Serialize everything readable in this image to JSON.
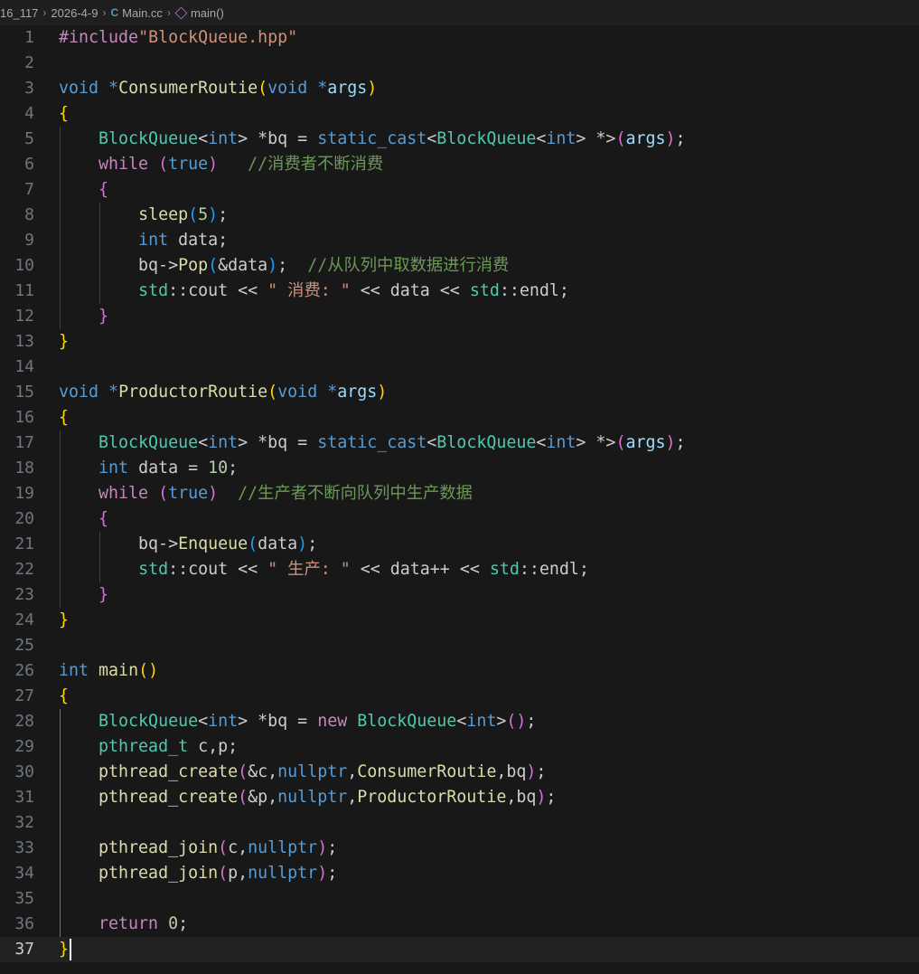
{
  "breadcrumb": {
    "folder": "16_117",
    "subfolder": "2026-4-9",
    "file": "Main.cc",
    "symbol": "main()"
  },
  "editor": {
    "cursor_line": 37,
    "lines": [
      {
        "n": "1",
        "tokens": [
          [
            "inc",
            "#include"
          ],
          [
            "str",
            "\"BlockQueue.hpp\""
          ]
        ]
      },
      {
        "n": "2",
        "tokens": []
      },
      {
        "n": "3",
        "tokens": [
          [
            "kw",
            "void"
          ],
          [
            "",
            "",
            " "
          ],
          [
            "kw",
            "*"
          ],
          [
            "fn",
            "ConsumerRoutie"
          ],
          [
            "b1",
            "("
          ],
          [
            "kw",
            "void"
          ],
          [
            "",
            "",
            " "
          ],
          [
            "kw",
            "*"
          ],
          [
            "pm",
            "args"
          ],
          [
            "b1",
            ")"
          ]
        ]
      },
      {
        "n": "4",
        "tokens": [
          [
            "b1",
            "{"
          ]
        ]
      },
      {
        "n": "5",
        "tokens": [
          [
            "",
            "    "
          ],
          [
            "ty",
            "BlockQueue"
          ],
          [
            "",
            "<"
          ],
          [
            "kw",
            "int"
          ],
          [
            "",
            "> *bq = "
          ],
          [
            "kw",
            "static_cast"
          ],
          [
            "",
            "<"
          ],
          [
            "ty",
            "BlockQueue"
          ],
          [
            "",
            "<"
          ],
          [
            "kw",
            "int"
          ],
          [
            "",
            "> *>"
          ],
          [
            "b2",
            "("
          ],
          [
            "pm",
            "args"
          ],
          [
            "b2",
            ")"
          ],
          [
            "",
            ";"
          ]
        ]
      },
      {
        "n": "6",
        "tokens": [
          [
            "",
            "    "
          ],
          [
            "ctl",
            "while"
          ],
          [
            "",
            " "
          ],
          [
            "b2",
            "("
          ],
          [
            "kw",
            "true"
          ],
          [
            "b2",
            ")"
          ],
          [
            "",
            "   "
          ],
          [
            "cm",
            "//消费者不断消费"
          ]
        ]
      },
      {
        "n": "7",
        "tokens": [
          [
            "",
            "    "
          ],
          [
            "b2",
            "{"
          ]
        ]
      },
      {
        "n": "8",
        "tokens": [
          [
            "",
            "        "
          ],
          [
            "fn",
            "sleep"
          ],
          [
            "b3",
            "("
          ],
          [
            "num",
            "5"
          ],
          [
            "b3",
            ")"
          ],
          [
            "",
            ";"
          ]
        ]
      },
      {
        "n": "9",
        "tokens": [
          [
            "",
            "        "
          ],
          [
            "kw",
            "int"
          ],
          [
            "",
            " data;"
          ]
        ]
      },
      {
        "n": "10",
        "tokens": [
          [
            "",
            "        bq->"
          ],
          [
            "fn",
            "Pop"
          ],
          [
            "b3",
            "("
          ],
          [
            "",
            "&data"
          ],
          [
            "b3",
            ")"
          ],
          [
            "",
            ";  "
          ],
          [
            "cm",
            "//从队列中取数据进行消费"
          ]
        ]
      },
      {
        "n": "11",
        "tokens": [
          [
            "",
            "        "
          ],
          [
            "ty",
            "std"
          ],
          [
            "",
            "::cout << "
          ],
          [
            "str",
            "\" 消费: \""
          ],
          [
            "",
            " << data << "
          ],
          [
            "ty",
            "std"
          ],
          [
            "",
            "::endl;"
          ]
        ]
      },
      {
        "n": "12",
        "tokens": [
          [
            "",
            "    "
          ],
          [
            "b2",
            "}"
          ]
        ]
      },
      {
        "n": "13",
        "tokens": [
          [
            "b1",
            "}"
          ]
        ]
      },
      {
        "n": "14",
        "tokens": []
      },
      {
        "n": "15",
        "tokens": [
          [
            "kw",
            "void"
          ],
          [
            "",
            " "
          ],
          [
            "kw",
            "*"
          ],
          [
            "fn",
            "ProductorRoutie"
          ],
          [
            "b1",
            "("
          ],
          [
            "kw",
            "void"
          ],
          [
            "",
            " "
          ],
          [
            "kw",
            "*"
          ],
          [
            "pm",
            "args"
          ],
          [
            "b1",
            ")"
          ]
        ]
      },
      {
        "n": "16",
        "tokens": [
          [
            "b1",
            "{"
          ]
        ]
      },
      {
        "n": "17",
        "tokens": [
          [
            "",
            "    "
          ],
          [
            "ty",
            "BlockQueue"
          ],
          [
            "",
            "<"
          ],
          [
            "kw",
            "int"
          ],
          [
            "",
            "> *bq = "
          ],
          [
            "kw",
            "static_cast"
          ],
          [
            "",
            "<"
          ],
          [
            "ty",
            "BlockQueue"
          ],
          [
            "",
            "<"
          ],
          [
            "kw",
            "int"
          ],
          [
            "",
            "> *>"
          ],
          [
            "b2",
            "("
          ],
          [
            "pm",
            "args"
          ],
          [
            "b2",
            ")"
          ],
          [
            "",
            ";"
          ]
        ]
      },
      {
        "n": "18",
        "tokens": [
          [
            "",
            "    "
          ],
          [
            "kw",
            "int"
          ],
          [
            "",
            " data = "
          ],
          [
            "num",
            "10"
          ],
          [
            "",
            ";"
          ]
        ]
      },
      {
        "n": "19",
        "tokens": [
          [
            "",
            "    "
          ],
          [
            "ctl",
            "while"
          ],
          [
            "",
            " "
          ],
          [
            "b2",
            "("
          ],
          [
            "kw",
            "true"
          ],
          [
            "b2",
            ")"
          ],
          [
            "",
            "  "
          ],
          [
            "cm",
            "//生产者不断向队列中生产数据"
          ]
        ]
      },
      {
        "n": "20",
        "tokens": [
          [
            "",
            "    "
          ],
          [
            "b2",
            "{"
          ]
        ]
      },
      {
        "n": "21",
        "tokens": [
          [
            "",
            "        bq->"
          ],
          [
            "fn",
            "Enqueue"
          ],
          [
            "b3",
            "("
          ],
          [
            "",
            "data"
          ],
          [
            "b3",
            ")"
          ],
          [
            "",
            ";"
          ]
        ]
      },
      {
        "n": "22",
        "tokens": [
          [
            "",
            "        "
          ],
          [
            "ty",
            "std"
          ],
          [
            "",
            "::cout << "
          ],
          [
            "str",
            "\" 生产: \""
          ],
          [
            "",
            " << data++ << "
          ],
          [
            "ty",
            "std"
          ],
          [
            "",
            "::endl;"
          ]
        ]
      },
      {
        "n": "23",
        "tokens": [
          [
            "",
            "    "
          ],
          [
            "b2",
            "}"
          ]
        ]
      },
      {
        "n": "24",
        "tokens": [
          [
            "b1",
            "}"
          ]
        ]
      },
      {
        "n": "25",
        "tokens": []
      },
      {
        "n": "26",
        "tokens": [
          [
            "kw",
            "int"
          ],
          [
            "",
            " "
          ],
          [
            "fn",
            "main"
          ],
          [
            "b1",
            "()"
          ]
        ]
      },
      {
        "n": "27",
        "tokens": [
          [
            "b1",
            "{"
          ]
        ]
      },
      {
        "n": "28",
        "tokens": [
          [
            "",
            "    "
          ],
          [
            "ty",
            "BlockQueue"
          ],
          [
            "",
            "<"
          ],
          [
            "kw",
            "int"
          ],
          [
            "",
            "> *bq = "
          ],
          [
            "ctl",
            "new"
          ],
          [
            "",
            " "
          ],
          [
            "ty",
            "BlockQueue"
          ],
          [
            "",
            "<"
          ],
          [
            "kw",
            "int"
          ],
          [
            "",
            ">"
          ],
          [
            "b2",
            "()"
          ],
          [
            "",
            ";"
          ]
        ]
      },
      {
        "n": "29",
        "tokens": [
          [
            "",
            "    "
          ],
          [
            "ty",
            "pthread_t"
          ],
          [
            "",
            " c,p;"
          ]
        ]
      },
      {
        "n": "30",
        "tokens": [
          [
            "",
            "    "
          ],
          [
            "fn",
            "pthread_create"
          ],
          [
            "b2",
            "("
          ],
          [
            "",
            "&c,"
          ],
          [
            "kw",
            "nullptr"
          ],
          [
            "",
            ","
          ],
          [
            "fn",
            "ConsumerRoutie"
          ],
          [
            "",
            ",bq"
          ],
          [
            "b2",
            ")"
          ],
          [
            "",
            ";"
          ]
        ]
      },
      {
        "n": "31",
        "tokens": [
          [
            "",
            "    "
          ],
          [
            "fn",
            "pthread_create"
          ],
          [
            "b2",
            "("
          ],
          [
            "",
            "&p,"
          ],
          [
            "kw",
            "nullptr"
          ],
          [
            "",
            ","
          ],
          [
            "fn",
            "ProductorRoutie"
          ],
          [
            "",
            ",bq"
          ],
          [
            "b2",
            ")"
          ],
          [
            "",
            ";"
          ]
        ]
      },
      {
        "n": "32",
        "tokens": []
      },
      {
        "n": "33",
        "tokens": [
          [
            "",
            "    "
          ],
          [
            "fn",
            "pthread_join"
          ],
          [
            "b2",
            "("
          ],
          [
            "",
            "c,"
          ],
          [
            "kw",
            "nullptr"
          ],
          [
            "b2",
            ")"
          ],
          [
            "",
            ";"
          ]
        ]
      },
      {
        "n": "34",
        "tokens": [
          [
            "",
            "    "
          ],
          [
            "fn",
            "pthread_join"
          ],
          [
            "b2",
            "("
          ],
          [
            "",
            "p,"
          ],
          [
            "kw",
            "nullptr"
          ],
          [
            "b2",
            ")"
          ],
          [
            "",
            ";"
          ]
        ]
      },
      {
        "n": "35",
        "tokens": []
      },
      {
        "n": "36",
        "tokens": [
          [
            "",
            "    "
          ],
          [
            "ctl",
            "return"
          ],
          [
            "",
            " "
          ],
          [
            "num",
            "0"
          ],
          [
            "",
            ";"
          ]
        ]
      },
      {
        "n": "37",
        "tokens": [
          [
            "b1",
            "}"
          ]
        ]
      }
    ]
  }
}
